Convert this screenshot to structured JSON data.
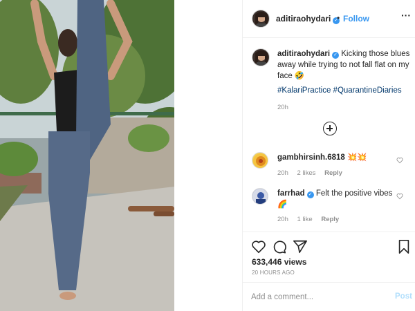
{
  "post": {
    "username": "aditiraohydari",
    "verified": true,
    "follow_label": "Follow",
    "dot_separator": "•",
    "more_label": "···"
  },
  "caption": {
    "username": "aditiraohydari",
    "text": "Kicking those blues away while trying to not fall flat on my face 🤣",
    "hashtags": [
      "#KalariPractice",
      "#QuarantineDiaries"
    ],
    "time": "20h"
  },
  "load_more_icon": "plus-circle-icon",
  "comments": [
    {
      "username": "gambhirsinh.6818",
      "text": "💥💥",
      "time": "20h",
      "likes": "2 likes",
      "reply_label": "Reply"
    },
    {
      "username": "farrhad",
      "verified": true,
      "text": "Felt the positive vibes 🌈",
      "time": "20h",
      "likes": "1 like",
      "reply_label": "Reply"
    }
  ],
  "stats": {
    "views": "633,446 views",
    "posted": "20 HOURS AGO"
  },
  "add_comment": {
    "placeholder": "Add a comment...",
    "post_label": "Post"
  },
  "colors": {
    "accent": "#3897f0",
    "hashtag": "#00376b",
    "muted": "#8e8e8e",
    "post_disabled": "#b2dffc",
    "border": "#efefef"
  }
}
